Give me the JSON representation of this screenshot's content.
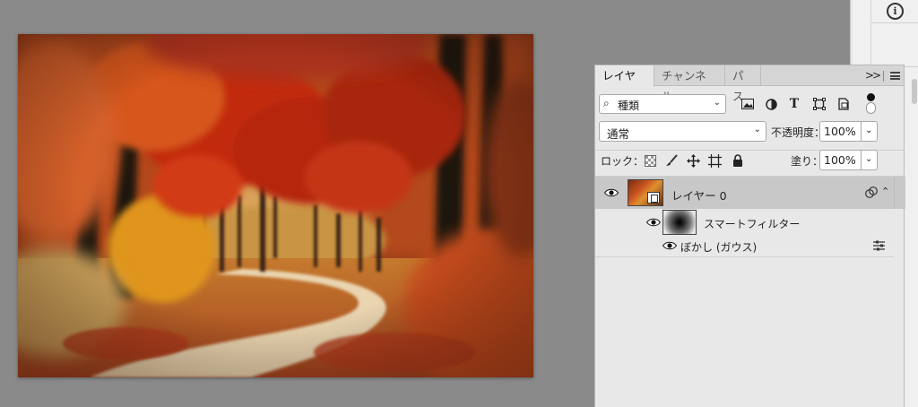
{
  "strip": {
    "info_glyph": "i"
  },
  "layers_panel": {
    "tabs": [
      {
        "label": "レイヤー",
        "active": true
      },
      {
        "label": "チャンネル",
        "active": false
      },
      {
        "label": "パス",
        "active": false
      }
    ],
    "collapse_label": ">>",
    "filter": {
      "label": "種類",
      "search_glyph": "⌕",
      "chevron": "⌄"
    },
    "filter_icons": [
      "image-icon",
      "adjustment-icon",
      "type-icon",
      "shape-icon",
      "smart-object-icon"
    ],
    "type_glyph": "T",
    "blend_mode": "通常",
    "opacity_label": "不透明度：",
    "opacity_value": "100%",
    "lock_label": "ロック：",
    "lock_icons": [
      "transparent-pixels-lock-icon",
      "brush-lock-icon",
      "move-lock-icon",
      "artboard-lock-icon",
      "padlock-icon"
    ],
    "fill_label": "塗り：",
    "fill_value": "100%",
    "layer": {
      "name": "レイヤー 0",
      "expand_glyph": "⌃"
    },
    "smart_filters": {
      "label": "スマートフィルター"
    },
    "blur_filter": {
      "label": "ぼかし (ガウス)"
    },
    "dropdown_glyph": "⌄"
  },
  "colors": {
    "workspace": "#8a8a8a",
    "panel": "#e8e8e8",
    "selected_layer": "#c8c8c8"
  }
}
